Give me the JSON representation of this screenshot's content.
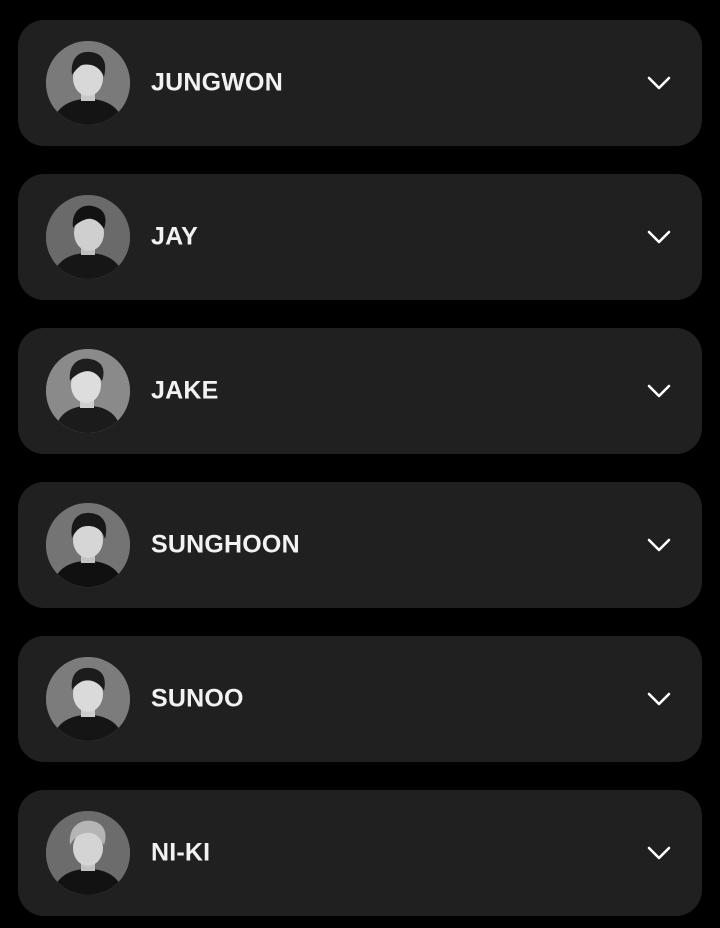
{
  "colors": {
    "background": "#000000",
    "card": "#202020",
    "text": "#f2f2f2",
    "chevron": "#ffffff"
  },
  "members": [
    {
      "name": "JUNGWON",
      "avatar_icon": "member-portrait",
      "toggle_icon": "chevron-down-icon"
    },
    {
      "name": "JAY",
      "avatar_icon": "member-portrait",
      "toggle_icon": "chevron-down-icon"
    },
    {
      "name": "JAKE",
      "avatar_icon": "member-portrait",
      "toggle_icon": "chevron-down-icon"
    },
    {
      "name": "SUNGHOON",
      "avatar_icon": "member-portrait",
      "toggle_icon": "chevron-down-icon"
    },
    {
      "name": "SUNOO",
      "avatar_icon": "member-portrait",
      "toggle_icon": "chevron-down-icon"
    },
    {
      "name": "NI-KI",
      "avatar_icon": "member-portrait",
      "toggle_icon": "chevron-down-icon"
    }
  ]
}
